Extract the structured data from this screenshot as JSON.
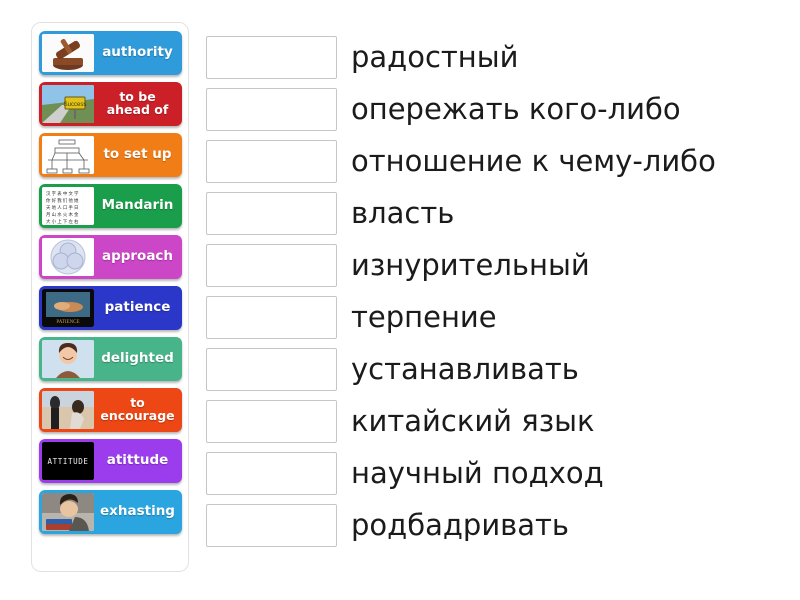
{
  "exercise": {
    "type": "match-up",
    "tile_count": 10,
    "slot_count": 10
  },
  "tiles": [
    {
      "label": "authority",
      "color": "#2f9bdb",
      "image": "gavel-photo"
    },
    {
      "label": "to be ahead of",
      "color": "#cc2028",
      "image": "road-sign-photo"
    },
    {
      "label": "to set up",
      "color": "#f07d16",
      "image": "diagram-sketch"
    },
    {
      "label": "Mandarin",
      "color": "#1a9e4b",
      "image": "chinese-characters-chart"
    },
    {
      "label": "approach",
      "color": "#cc46c8",
      "image": "venn-diagram"
    },
    {
      "label": "patience",
      "color": "#2b37c9",
      "image": "patience-poster"
    },
    {
      "label": "delighted",
      "color": "#47b48a",
      "image": "smiling-woman-photo"
    },
    {
      "label": "to encourage",
      "color": "#ec4715",
      "image": "two-people-photo"
    },
    {
      "label": "atittude",
      "color": "#9b3ced",
      "image": "attitude-black-poster"
    },
    {
      "label": "exhasting",
      "color": "#2aa5e0",
      "image": "tired-man-photo"
    }
  ],
  "definitions": [
    "радостный",
    "опережать кого-либо",
    "отношение к чему-либо",
    "власть",
    "изнурительный",
    "терпение",
    "устанавливать",
    "китайский язык",
    "научный подход",
    "родбадривать"
  ],
  "colors": {
    "page_background": "#ffffff",
    "panel_border": "#e2e2e2",
    "dropzone_border": "#c6c6c6",
    "definition_text": "#1b1b1b",
    "tile_text": "#ffffff"
  }
}
